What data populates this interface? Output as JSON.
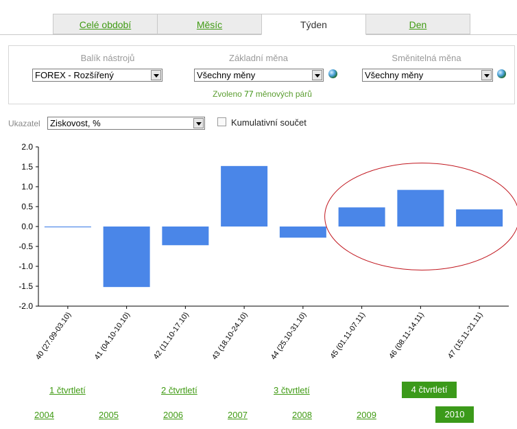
{
  "tabs": [
    {
      "label": "Celé období",
      "active": false
    },
    {
      "label": "Měsíc",
      "active": false
    },
    {
      "label": "Týden",
      "active": true
    },
    {
      "label": "Den",
      "active": false
    }
  ],
  "filters": {
    "toolkit": {
      "label": "Balík nástrojů",
      "value": "FOREX - Rozšířený"
    },
    "base_currency": {
      "label": "Základní měna",
      "value": "Všechny měny"
    },
    "quote_currency": {
      "label": "Směnitelná měna",
      "value": "Všechny měny"
    },
    "selected_prefix": "Zvoleno",
    "selected_count": "77",
    "selected_suffix": "měnových párů"
  },
  "indicator": {
    "label": "Ukazatel",
    "value": "Ziskovost, %",
    "cumulative_label": "Kumulativní součet",
    "cumulative_checked": false
  },
  "chart_data": {
    "type": "bar",
    "categories": [
      "40 (27.09-03.10)",
      "41 (04.10-10.10)",
      "42 (11.10-17.10)",
      "43 (18.10-24.10)",
      "44 (25.10-31.10)",
      "45 (01.11-07.11)",
      "46 (08.11-14.11)",
      "47 (15.11-21.11)"
    ],
    "values": [
      -0.02,
      -1.52,
      -0.47,
      1.52,
      -0.28,
      0.48,
      0.92,
      0.43
    ],
    "ylim": [
      -2.0,
      2.0
    ],
    "yticks": [
      "2.0",
      "1.5",
      "1.0",
      "0.5",
      "0.0",
      "-0.5",
      "-1.0",
      "-1.5",
      "-2.0"
    ],
    "bar_color": "#4a86e8",
    "annotation_color": "#c0141c",
    "grid": false
  },
  "quarters": [
    {
      "label": "1 čtvrtletí",
      "active": false
    },
    {
      "label": "2 čtvrtletí",
      "active": false
    },
    {
      "label": "3 čtvrtletí",
      "active": false
    },
    {
      "label": "4 čtvrtletí",
      "active": true
    }
  ],
  "years": [
    {
      "label": "2004",
      "active": false
    },
    {
      "label": "2005",
      "active": false
    },
    {
      "label": "2006",
      "active": false
    },
    {
      "label": "2007",
      "active": false
    },
    {
      "label": "2008",
      "active": false
    },
    {
      "label": "2009",
      "active": false
    },
    {
      "label": "2010",
      "active": true
    }
  ]
}
